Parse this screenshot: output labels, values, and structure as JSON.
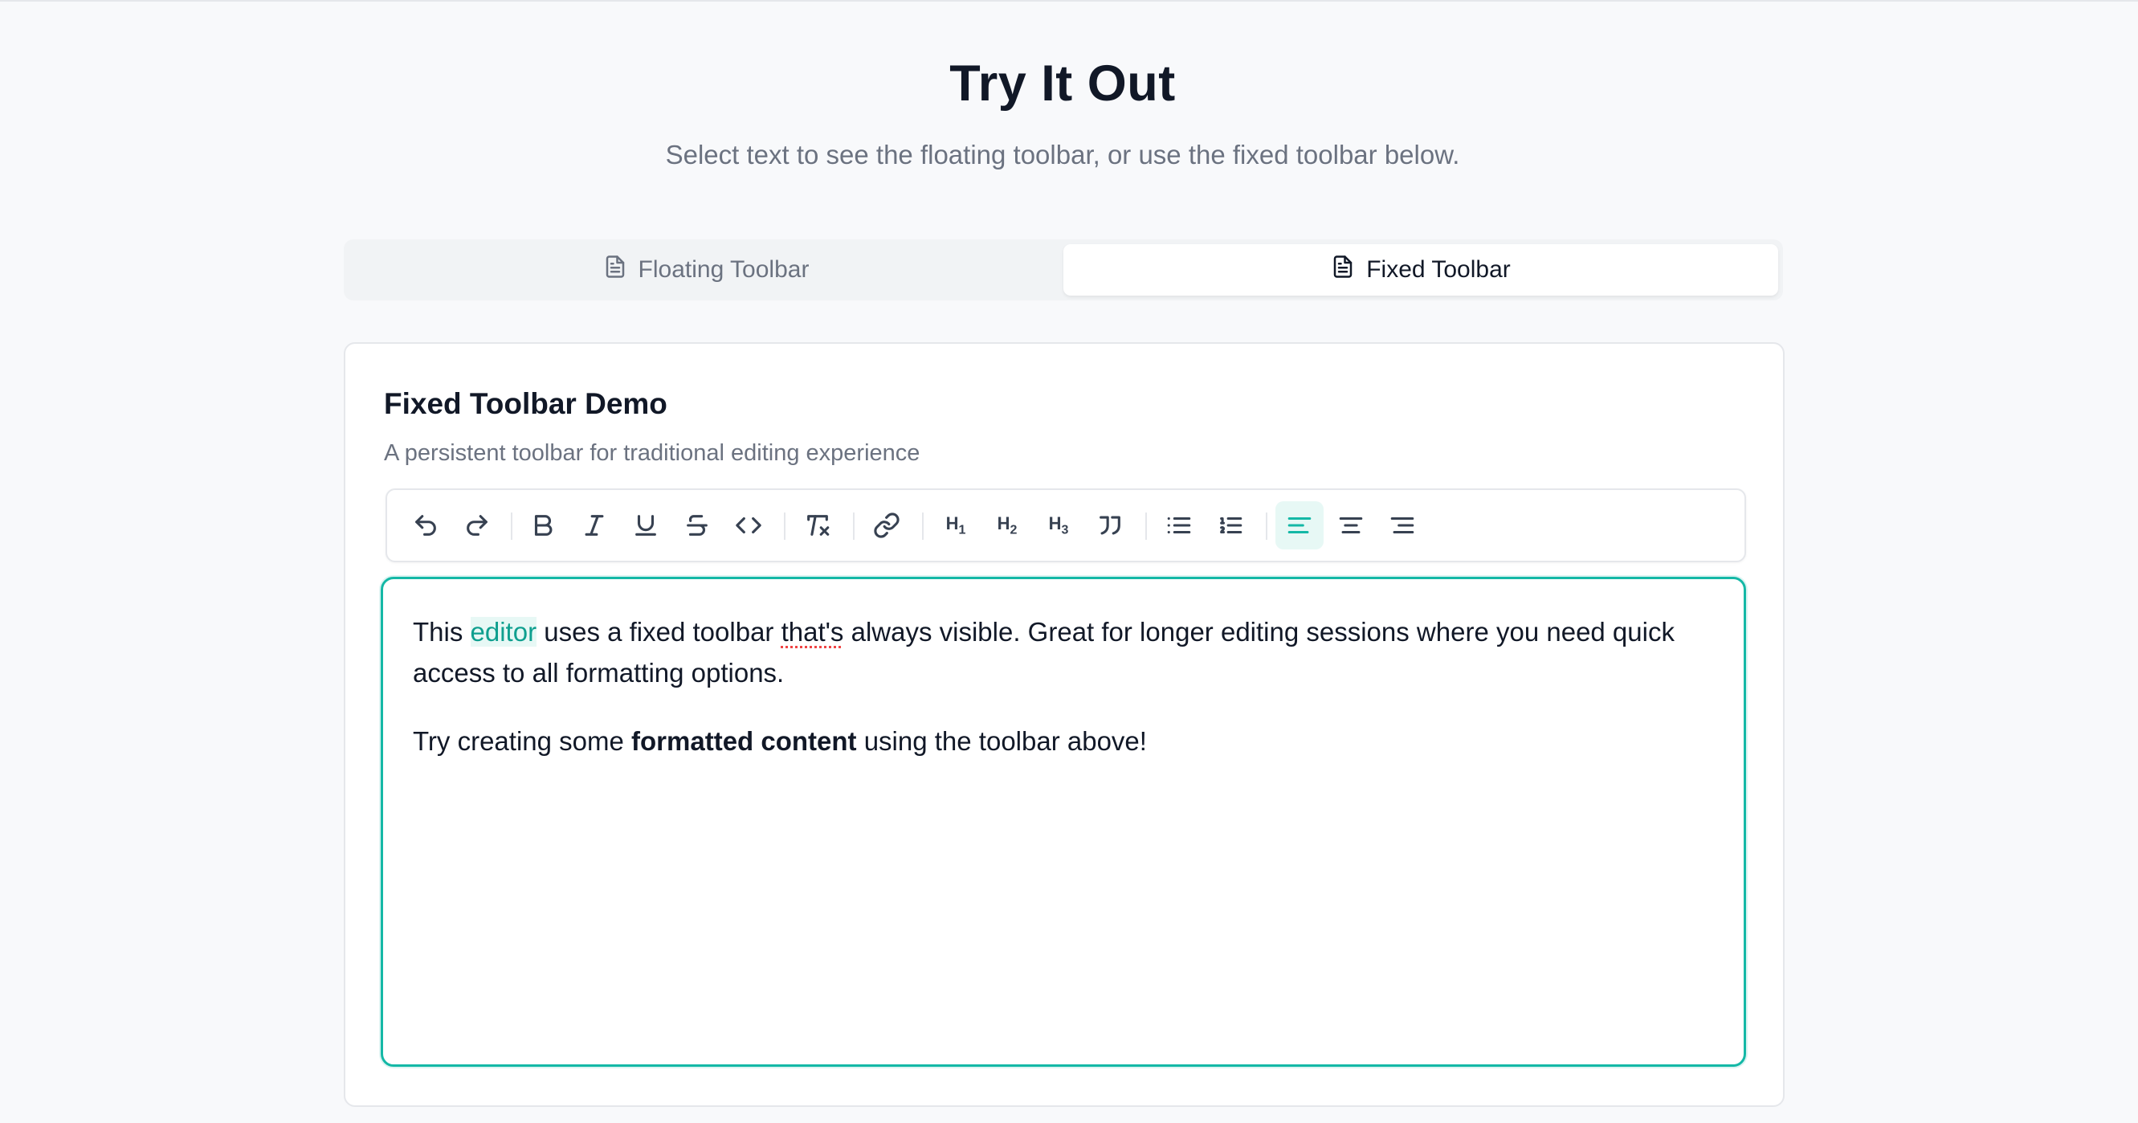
{
  "header": {
    "title": "Try It Out",
    "subtitle": "Select text to see the floating toolbar, or use the fixed toolbar below."
  },
  "tabs": [
    {
      "label": "Floating Toolbar",
      "selected": false
    },
    {
      "label": "Fixed Toolbar",
      "selected": true
    }
  ],
  "card": {
    "title": "Fixed Toolbar Demo",
    "description": "A persistent toolbar for traditional editing experience"
  },
  "toolbar": {
    "buttons": [
      "undo",
      "redo",
      "bold",
      "italic",
      "underline",
      "strikethrough",
      "code",
      "clear-formatting",
      "link",
      "heading-1",
      "heading-2",
      "heading-3",
      "blockquote",
      "bullet-list",
      "ordered-list",
      "align-left",
      "align-center",
      "align-right"
    ],
    "active": "align-left",
    "h1_label": "H",
    "h1_sub": "1",
    "h2_label": "H",
    "h2_sub": "2",
    "h3_label": "H",
    "h3_sub": "3"
  },
  "editor": {
    "p1_before": "This ",
    "p1_highlight": "editor",
    "p1_mid": " uses a fixed toolbar ",
    "p1_misspelled": "that's",
    "p1_after": " always visible. Great for longer editing sessions where you need quick access to all formatting options.",
    "p2_before": "Try creating some ",
    "p2_bold": "formatted content",
    "p2_after": " using the toolbar above!"
  },
  "colors": {
    "accent": "#14b8a6",
    "accent_bg": "#e7f8f5",
    "text": "#111827",
    "muted": "#6b7280",
    "border": "#e5e7eb"
  }
}
